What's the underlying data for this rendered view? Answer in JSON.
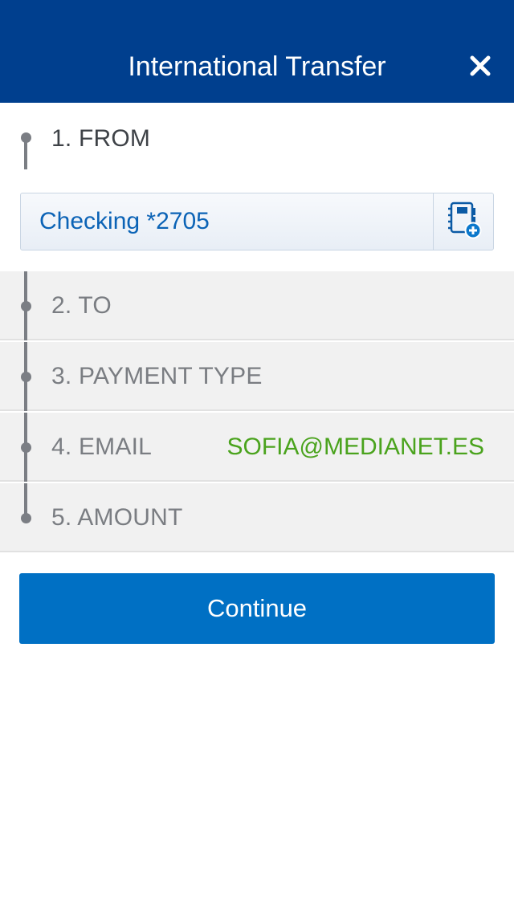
{
  "header": {
    "title": "International Transfer",
    "close_icon": "close-icon"
  },
  "steps": {
    "from": {
      "label": "1. FROM",
      "account": "Checking *2705",
      "address_book_icon": "address-book-add-icon"
    },
    "to": {
      "label": "2. TO"
    },
    "payment_type": {
      "label": "3. PAYMENT TYPE"
    },
    "email": {
      "label": "4. EMAIL",
      "value": "SOFIA@MEDIANET.ES"
    },
    "amount": {
      "label": "5. AMOUNT"
    }
  },
  "actions": {
    "continue_label": "Continue"
  },
  "colors": {
    "header_bg": "#003f8e",
    "accent_blue": "#0070c4",
    "link_blue": "#0b63b6",
    "value_green": "#4aa31d",
    "row_bg": "#f1f1f1"
  }
}
